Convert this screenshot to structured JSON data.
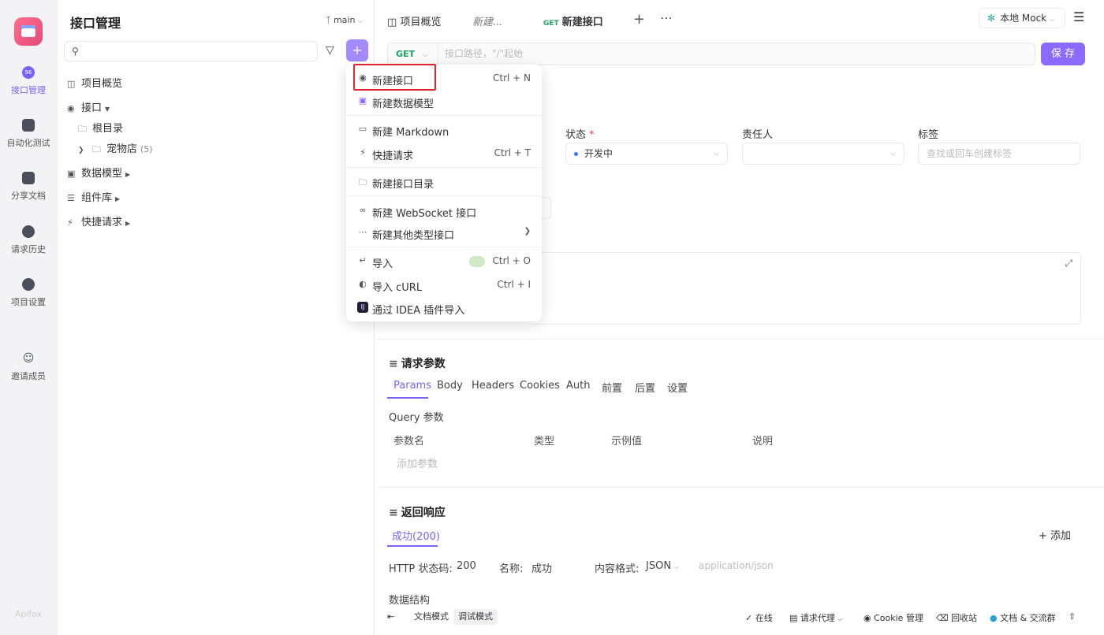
{
  "rail": {
    "items": [
      {
        "label": "接口管理",
        "badge": "96"
      },
      {
        "label": "自动化测试"
      },
      {
        "label": "分享文档"
      },
      {
        "label": "请求历史"
      },
      {
        "label": "项目设置"
      },
      {
        "label": "邀请成员"
      }
    ],
    "brand": "Apifox"
  },
  "tree": {
    "title": "接口管理",
    "branch": "main",
    "items": [
      {
        "label": "项目概览"
      },
      {
        "label": "接口"
      },
      {
        "label": "根目录"
      },
      {
        "label": "宠物店",
        "count": "(5)"
      },
      {
        "label": "数据模型"
      },
      {
        "label": "组件库"
      },
      {
        "label": "快捷请求"
      }
    ]
  },
  "tabs": [
    {
      "label": "项目概览"
    },
    {
      "label": "新建..."
    },
    {
      "method": "GET",
      "label": "新建接口"
    }
  ],
  "mock": {
    "label": "本地 Mock"
  },
  "request": {
    "method": "GET",
    "url_placeholder": "接口路径，\"/\"起始",
    "save_label": "保 存"
  },
  "fields": {
    "status_label": "状态",
    "required_mark": "*",
    "status_value": "开发中",
    "owner_label": "责任人",
    "tags_label": "标签",
    "tags_placeholder": "查找或回车创建标签"
  },
  "request_params": {
    "title": "请求参数",
    "tabs": [
      "Params",
      "Body",
      "Headers",
      "Cookies",
      "Auth",
      "前置",
      "后置",
      "设置"
    ],
    "query_label": "Query 参数",
    "columns": [
      "参数名",
      "类型",
      "示例值",
      "说明"
    ],
    "add_param": "添加参数"
  },
  "response": {
    "title": "返回响应",
    "tab": "成功(200)",
    "add_label": "+ 添加",
    "status_code_label": "HTTP 状态码:",
    "status_code": "200",
    "name_label": "名称:",
    "name_value": "成功",
    "format_label": "内容格式:",
    "format_value": "JSON",
    "content_type": "application/json",
    "schema_label": "数据结构"
  },
  "statusbar": {
    "doc_mode": "文档模式",
    "debug_mode": "调试模式",
    "online": "在线",
    "proxy": "请求代理",
    "cookie": "Cookie 管理",
    "trash": "回收站",
    "community": "文档 & 交流群"
  },
  "dropdown": {
    "items": [
      {
        "label": "新建接口",
        "shortcut": "Ctrl + N"
      },
      {
        "label": "新建数据模型"
      },
      {
        "label": "新建 Markdown"
      },
      {
        "label": "快捷请求",
        "shortcut": "Ctrl + T"
      },
      {
        "label": "新建接口目录"
      },
      {
        "label": "新建 WebSocket 接口"
      },
      {
        "label": "新建其他类型接口"
      },
      {
        "label": "导入",
        "shortcut": "Ctrl + O"
      },
      {
        "label": "导入 cURL",
        "shortcut": "Ctrl + I"
      },
      {
        "label": "通过 IDEA 插件导入"
      }
    ]
  }
}
